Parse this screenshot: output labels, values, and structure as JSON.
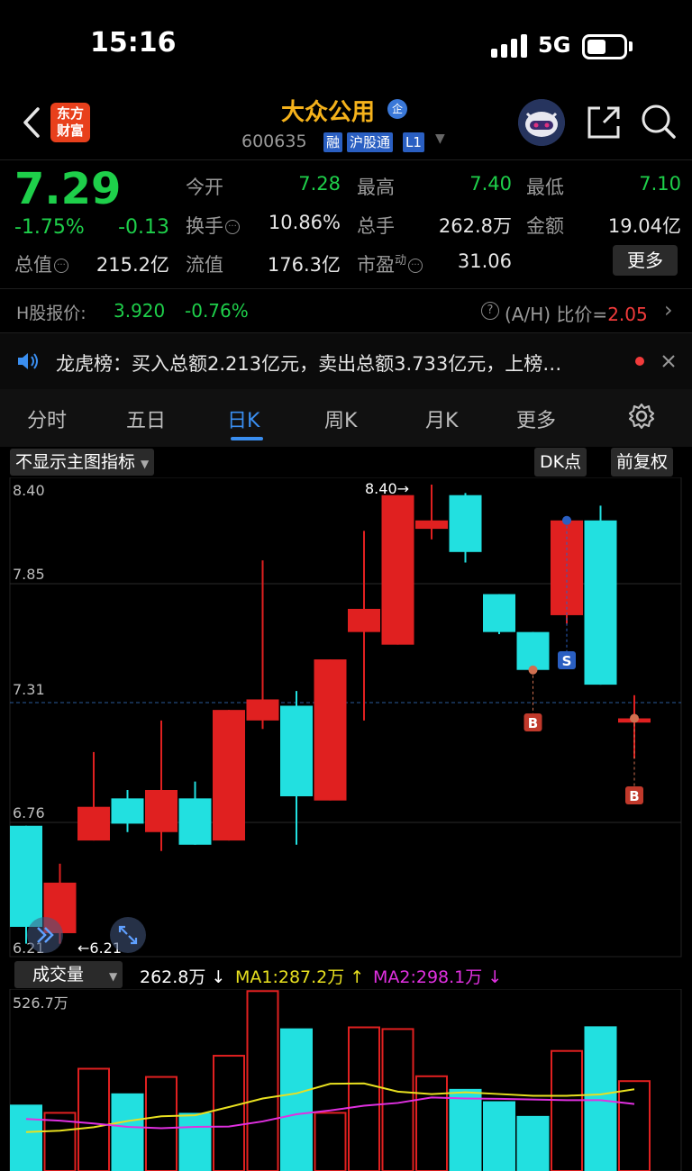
{
  "status_bar": {
    "time": "15:16",
    "network": "5G"
  },
  "header": {
    "logo_text": "东方财富",
    "stock_name": "大众公用",
    "badge": "企",
    "stock_code": "600635",
    "tags": [
      "融",
      "沪股通",
      "L1"
    ]
  },
  "quote": {
    "price": "7.29",
    "change_pct": "-1.75%",
    "change": "-0.13",
    "fields": {
      "open_label": "今开",
      "open": "7.28",
      "high_label": "最高",
      "high": "7.40",
      "low_label": "最低",
      "low": "7.10",
      "turnover_label": "换手",
      "turnover": "10.86%",
      "volume_label": "总手",
      "volume": "262.8万",
      "amount_label": "金额",
      "amount": "19.04亿",
      "mktcap_label": "总值",
      "mktcap": "215.2亿",
      "float_label": "流值",
      "float": "176.3亿",
      "pe_label": "市盈",
      "pe_sup": "动",
      "pe": "31.06"
    },
    "more_label": "更多"
  },
  "hshare": {
    "label": "H股报价:",
    "price": "3.920",
    "pct": "-0.76%",
    "ah_label": "(A/H) 比价=",
    "ah_value": "2.05"
  },
  "news": {
    "text": "龙虎榜：买入总额2.213亿元，卖出总额3.733亿元，上榜…"
  },
  "tabs": [
    "分时",
    "五日",
    "日K",
    "周K",
    "月K",
    "更多"
  ],
  "active_tab": "日K",
  "chart": {
    "indicator_select": "不显示主图指标",
    "dk_label": "DK点",
    "adjust_label": "前复权",
    "price_ticks": [
      "8.40",
      "7.85",
      "7.31",
      "6.76",
      "6.21"
    ],
    "high_marker": "8.40",
    "low_marker": "6.21",
    "signal_buy": "B",
    "signal_sell": "S",
    "volume_select": "成交量",
    "volume_value": "262.8万",
    "ma1_label": "MA1:287.2万",
    "ma2_label": "MA2:298.1万",
    "volume_top": "526.7万"
  },
  "colors": {
    "up": "#e02020",
    "down": "#22e0e0",
    "ma1": "#e8e020",
    "ma2": "#e030e0",
    "accent": "#3a8ef0"
  },
  "chart_data": {
    "type": "candlestick",
    "ylim": [
      6.21,
      8.4
    ],
    "candles": [
      {
        "open": 6.78,
        "close": 6.3,
        "high": 6.78,
        "low": 6.22
      },
      {
        "open": 6.27,
        "close": 6.51,
        "high": 6.6,
        "low": 6.22
      },
      {
        "open": 6.71,
        "close": 6.87,
        "high": 7.13,
        "low": 6.71
      },
      {
        "open": 6.91,
        "close": 6.79,
        "high": 6.95,
        "low": 6.75
      },
      {
        "open": 6.75,
        "close": 6.95,
        "high": 7.28,
        "low": 6.66
      },
      {
        "open": 6.91,
        "close": 6.69,
        "high": 6.99,
        "low": 6.69
      },
      {
        "open": 6.71,
        "close": 7.33,
        "high": 7.33,
        "low": 6.71
      },
      {
        "open": 7.28,
        "close": 7.38,
        "high": 8.04,
        "low": 7.24
      },
      {
        "open": 7.35,
        "close": 6.92,
        "high": 7.42,
        "low": 6.69
      },
      {
        "open": 6.9,
        "close": 7.57,
        "high": 7.57,
        "low": 6.9
      },
      {
        "open": 7.7,
        "close": 7.81,
        "high": 8.18,
        "low": 7.28
      },
      {
        "open": 7.64,
        "close": 8.35,
        "high": 8.35,
        "low": 7.64
      },
      {
        "open": 8.19,
        "close": 8.23,
        "high": 8.4,
        "low": 8.14
      },
      {
        "open": 8.35,
        "close": 8.08,
        "high": 8.36,
        "low": 8.03
      },
      {
        "open": 7.88,
        "close": 7.7,
        "high": 7.88,
        "low": 7.69
      },
      {
        "open": 7.7,
        "close": 7.52,
        "high": 7.7,
        "low": 7.52
      },
      {
        "open": 7.78,
        "close": 8.23,
        "high": 8.23,
        "low": 7.74
      },
      {
        "open": 8.23,
        "close": 7.45,
        "high": 8.3,
        "low": 7.45
      },
      {
        "open": 7.27,
        "close": 7.29,
        "high": 7.4,
        "low": 7.1
      }
    ],
    "volume": {
      "ymax": 526.7,
      "values": [
        194,
        170,
        299,
        227,
        275,
        170,
        337,
        526,
        417,
        170,
        420,
        415,
        277,
        240,
        204,
        161,
        351,
        423,
        262.8
      ],
      "ma1": [
        114,
        118,
        128,
        146,
        160,
        163,
        187,
        212,
        227,
        255,
        256,
        232,
        225,
        230,
        225,
        220,
        220,
        224,
        239
      ],
      "ma2": [
        152,
        147,
        139,
        129,
        125,
        129,
        130,
        145,
        166,
        177,
        191,
        199,
        215,
        212,
        211,
        209,
        207,
        207,
        196
      ]
    }
  }
}
